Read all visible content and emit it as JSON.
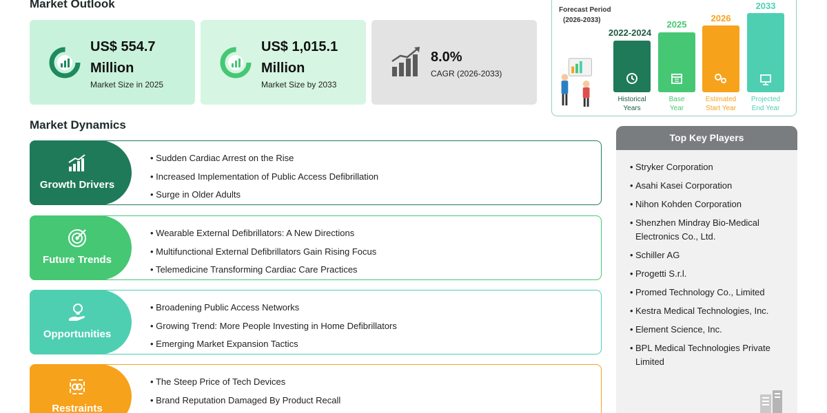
{
  "market_outlook": {
    "title": "Market Outlook",
    "cards": [
      {
        "value": "US$ 554.7 Million",
        "label": "Market Size in 2025",
        "icon": "donut-chart-icon",
        "color": "#c9f2dc"
      },
      {
        "value": "US$ 1,015.1 Million",
        "label": "Market Size by 2033",
        "icon": "donut-chart-icon",
        "color": "#d6f5e2"
      },
      {
        "value": "8.0%",
        "label": "CAGR (2026-2033)",
        "icon": "growth-bar-chart-icon",
        "color": "#e3e3e3"
      }
    ]
  },
  "forecast": {
    "title": "Forecast Period",
    "subtitle": "(2026-2033)",
    "bars": [
      {
        "year": "2022-2024",
        "caption": "Historical Years",
        "color": "#1f7a5a",
        "icon": "history-icon"
      },
      {
        "year": "2025",
        "caption": "Base Year",
        "color": "#46c774",
        "icon": "calendar-icon"
      },
      {
        "year": "2026",
        "caption": "Estimated Start Year",
        "color": "#f7a21b",
        "icon": "gears-icon"
      },
      {
        "year": "2033",
        "caption": "Projected End Year",
        "color": "#4ecfb2",
        "icon": "presentation-icon"
      }
    ]
  },
  "market_dynamics": {
    "title": "Market Dynamics",
    "rows": [
      {
        "label": "Growth Drivers",
        "color": "#1f7a5a",
        "icon": "bar-growth-icon",
        "items": [
          "Sudden Cardiac Arrest on the Rise",
          "Increased Implementation of Public Access Defibrillation",
          "Surge in Older Adults"
        ]
      },
      {
        "label": "Future Trends",
        "color": "#46c774",
        "icon": "target-icon",
        "items": [
          "Wearable External Defibrillators: A New Directions",
          "Multifunctional External Defibrillators Gain Rising Focus",
          "Telemedicine Transforming Cardiac Care Practices"
        ]
      },
      {
        "label": "Opportunities",
        "color": "#4ecfb2",
        "icon": "lightbulb-hand-icon",
        "items": [
          "Broadening Public Access Networks",
          "Growing Trend: More People Investing in Home Defibrillators",
          "Emerging Market Expansion Tactics"
        ]
      },
      {
        "label": "Restraints",
        "color": "#f7a21b",
        "icon": "restraint-icon",
        "items": [
          "The Steep Price of Tech Devices",
          "Brand Reputation Damaged By Product Recall",
          ""
        ]
      }
    ]
  },
  "top_key_players": {
    "title": "Top Key Players",
    "bullet": "•",
    "players": [
      "Stryker Corporation",
      "Asahi Kasei Corporation",
      "Nihon Kohden Corporation",
      "Shenzhen Mindray Bio-Medical Electronics Co., Ltd.",
      "Schiller AG",
      "Progetti S.r.l.",
      "Promed Technology Co., Limited",
      "Kestra Medical Technologies, Inc.",
      "Element Science, Inc.",
      "BPL Medical Technologies Private Limited"
    ]
  }
}
